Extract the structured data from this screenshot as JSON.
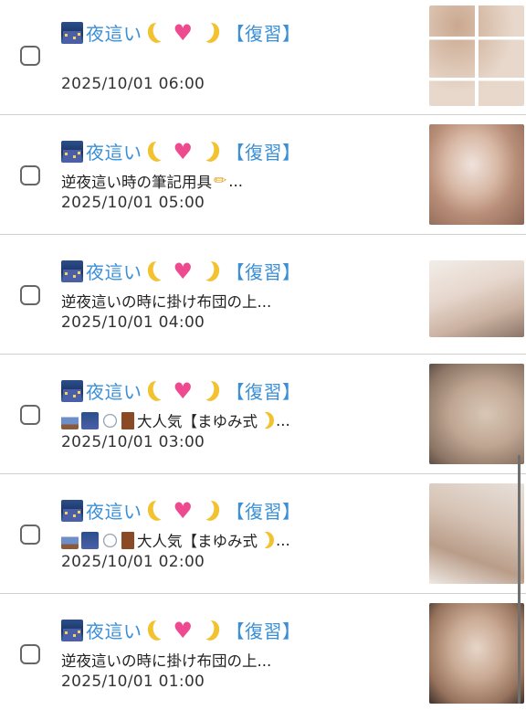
{
  "items": [
    {
      "title": "夜這い",
      "tag": "【復習】",
      "snippet": "",
      "date": "2025/10/01 06:00",
      "checked": false
    },
    {
      "title": "夜這い",
      "tag": "【復習】",
      "snippet": "逆夜這い時の筆記用具",
      "snippet_suffix": "...",
      "date": "2025/10/01 05:00",
      "checked": false
    },
    {
      "title": "夜這い",
      "tag": "【復習】",
      "snippet": "逆夜這いの時に掛け布団の上...",
      "date": "2025/10/01 04:00",
      "checked": false
    },
    {
      "title": "夜這い",
      "tag": "【復習】",
      "snippet": "大人気【まゆみ式",
      "snippet_suffix": "...",
      "date": "2025/10/01 03:00",
      "checked": false
    },
    {
      "title": "夜這い",
      "tag": "【復習】",
      "snippet": "大人気【まゆみ式",
      "snippet_suffix": "...",
      "date": "2025/10/01 02:00",
      "checked": false
    },
    {
      "title": "夜這い",
      "tag": "【復習】",
      "snippet": "逆夜這いの時に掛け布団の上...",
      "date": "2025/10/01 01:00",
      "checked": false
    }
  ],
  "icons": {
    "title": [
      "city-night-icon",
      "crescent-moon-icon",
      "heart-icon",
      "crescent-moon-icon"
    ],
    "snippet_promo": [
      "bed-icon",
      "city-night-icon",
      "thought-bubble-icon",
      "door-icon"
    ],
    "pencil": "pencil-icon"
  },
  "colors": {
    "title": "#3a8fd6",
    "divider": "#cfcfcf",
    "heart": "#ee4a8f",
    "moon": "#f2c230"
  }
}
